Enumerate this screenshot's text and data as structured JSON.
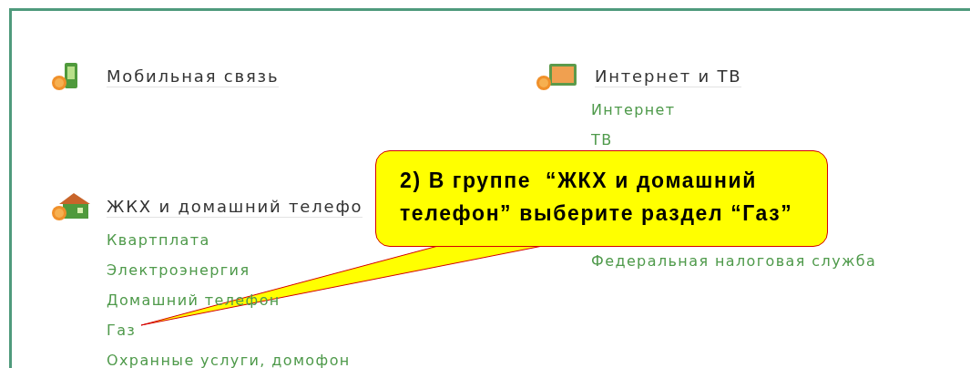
{
  "columns": [
    [
      {
        "title": "Мобильная связь",
        "kind": "phone"
      },
      {
        "title": "ЖКХ и домашний телефо",
        "kind": "house",
        "links": [
          "Квартплата",
          "Электроэнергия",
          "Домашний телефон",
          "Газ",
          "Охранные услуги, домофон"
        ]
      }
    ],
    [
      {
        "title": "Интернет и ТВ",
        "kind": "monitor",
        "links": [
          "Интернет",
          "ТВ"
        ]
      },
      {
        "links": [
          "Федеральная налоговая служба"
        ]
      }
    ]
  ],
  "callout": {
    "lines": [
      "2) В группе  “ЖКХ и домашний",
      "телефон” выберите раздел “Газ”"
    ]
  }
}
